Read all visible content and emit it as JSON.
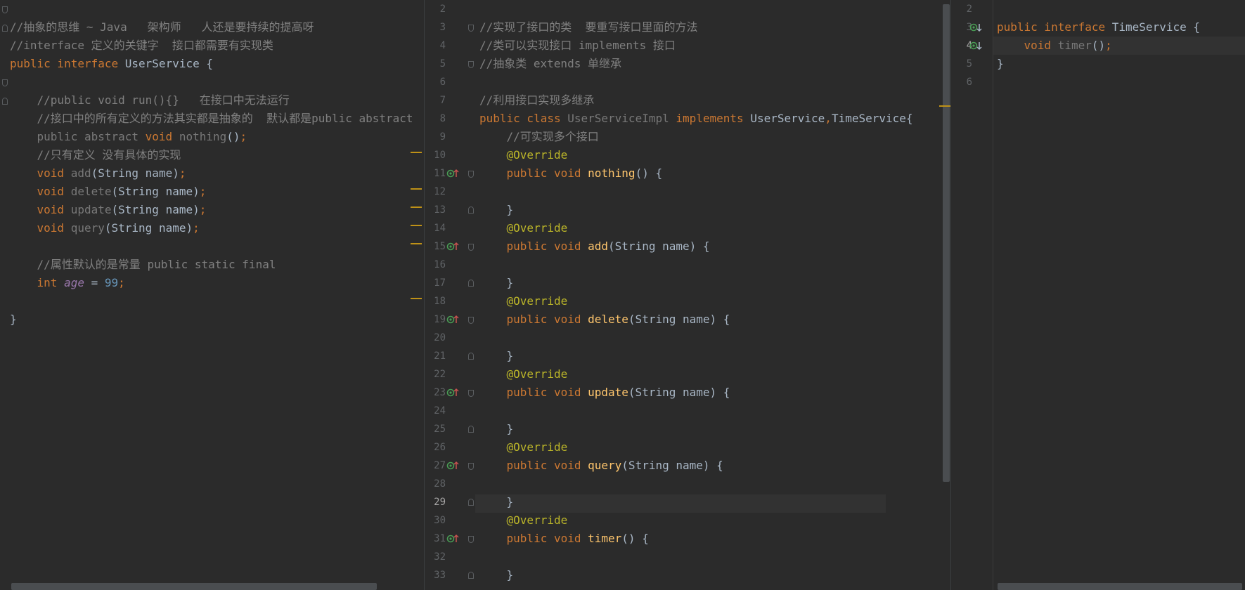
{
  "left_editor": {
    "lines": [
      {
        "row": 1,
        "parts": [
          {
            "t": "//抽象的思维 ~ Java   架构师   人还是要持续的提高呀",
            "c": "cm"
          }
        ]
      },
      {
        "row": 2,
        "parts": [
          {
            "t": "//interface 定义的关键字  接口都需要有实现类",
            "c": "cm"
          }
        ]
      },
      {
        "row": 3,
        "parts": [
          {
            "t": "public interface ",
            "c": "kw"
          },
          {
            "t": "UserService {",
            "c": "cl"
          }
        ]
      },
      {
        "row": 5,
        "parts": [
          {
            "t": "    //public void run(){}   在接口中无法运行",
            "c": "cm"
          }
        ]
      },
      {
        "row": 6,
        "parts": [
          {
            "t": "    //接口中的所有定义的方法其实都是抽象的  默认都是public abstract",
            "c": "cm"
          }
        ]
      },
      {
        "row": 7,
        "parts": [
          {
            "t": "    public abstract ",
            "c": "dim"
          },
          {
            "t": "void ",
            "c": "kw"
          },
          {
            "t": "nothing",
            "c": "dim"
          },
          {
            "t": "()",
            "c": "cl"
          },
          {
            "t": ";",
            "c": "sc"
          }
        ]
      },
      {
        "row": 8,
        "parts": [
          {
            "t": "    //只有定义 没有具体的实现",
            "c": "cm"
          }
        ]
      },
      {
        "row": 9,
        "parts": [
          {
            "t": "    void ",
            "c": "kw"
          },
          {
            "t": "add",
            "c": "dim"
          },
          {
            "t": "(String name)",
            "c": "cl"
          },
          {
            "t": ";",
            "c": "sc"
          }
        ]
      },
      {
        "row": 10,
        "parts": [
          {
            "t": "    void ",
            "c": "kw"
          },
          {
            "t": "delete",
            "c": "dim"
          },
          {
            "t": "(String name)",
            "c": "cl"
          },
          {
            "t": ";",
            "c": "sc"
          }
        ]
      },
      {
        "row": 11,
        "parts": [
          {
            "t": "    void ",
            "c": "kw"
          },
          {
            "t": "update",
            "c": "dim"
          },
          {
            "t": "(String name)",
            "c": "cl"
          },
          {
            "t": ";",
            "c": "sc"
          }
        ]
      },
      {
        "row": 12,
        "parts": [
          {
            "t": "    void ",
            "c": "kw"
          },
          {
            "t": "query",
            "c": "dim"
          },
          {
            "t": "(String name)",
            "c": "cl"
          },
          {
            "t": ";",
            "c": "sc"
          }
        ]
      },
      {
        "row": 14,
        "parts": [
          {
            "t": "    //属性默认的是常量 ",
            "c": "cm"
          },
          {
            "t": "public static final",
            "c": "gr"
          }
        ]
      },
      {
        "row": 15,
        "parts": [
          {
            "t": "    int ",
            "c": "kw"
          },
          {
            "t": "age",
            "c": "fd"
          },
          {
            "t": " = ",
            "c": "cl"
          },
          {
            "t": "99",
            "c": "nm"
          },
          {
            "t": ";",
            "c": "sc"
          }
        ]
      },
      {
        "row": 17,
        "parts": [
          {
            "t": "}",
            "c": "cl"
          }
        ]
      }
    ]
  },
  "middle_editor": {
    "line_numbers": [
      "2",
      "3",
      "4",
      "5",
      "6",
      "7",
      "8",
      "9",
      "10",
      "11",
      "12",
      "13",
      "14",
      "15",
      "16",
      "17",
      "18",
      "19",
      "20",
      "21",
      "22",
      "23",
      "24",
      "25",
      "26",
      "27",
      "28",
      "29",
      "30",
      "31",
      "32",
      "33"
    ],
    "current_line": "29",
    "lines": [
      {
        "row": 1,
        "parts": [
          {
            "t": "//实现了接口的类  要重写接口里面的方法",
            "c": "cm"
          }
        ]
      },
      {
        "row": 2,
        "parts": [
          {
            "t": "//类可以实现接口 implements 接口",
            "c": "cm"
          }
        ]
      },
      {
        "row": 3,
        "parts": [
          {
            "t": "//抽象类 extends 单继承",
            "c": "cm"
          }
        ]
      },
      {
        "row": 5,
        "parts": [
          {
            "t": "//利用接口实现多继承",
            "c": "cm"
          }
        ]
      },
      {
        "row": 6,
        "parts": [
          {
            "t": "public class ",
            "c": "kw"
          },
          {
            "t": "UserServiceImpl ",
            "c": "dim"
          },
          {
            "t": "implements ",
            "c": "kw"
          },
          {
            "t": "UserService",
            "c": "cl"
          },
          {
            "t": ",",
            "c": "sc"
          },
          {
            "t": "TimeService{",
            "c": "cl"
          }
        ]
      },
      {
        "row": 7,
        "parts": [
          {
            "t": "    //可实现多个接口",
            "c": "cm"
          }
        ]
      },
      {
        "row": 8,
        "parts": [
          {
            "t": "    @Override",
            "c": "an"
          }
        ]
      },
      {
        "row": 9,
        "parts": [
          {
            "t": "    public void ",
            "c": "kw"
          },
          {
            "t": "nothing",
            "c": "fn"
          },
          {
            "t": "() {",
            "c": "cl"
          }
        ]
      },
      {
        "row": 11,
        "parts": [
          {
            "t": "    }",
            "c": "cl"
          }
        ]
      },
      {
        "row": 12,
        "parts": [
          {
            "t": "    @Override",
            "c": "an"
          }
        ]
      },
      {
        "row": 13,
        "parts": [
          {
            "t": "    public void ",
            "c": "kw"
          },
          {
            "t": "add",
            "c": "fn"
          },
          {
            "t": "(String name) {",
            "c": "cl"
          }
        ]
      },
      {
        "row": 15,
        "parts": [
          {
            "t": "    }",
            "c": "cl"
          }
        ]
      },
      {
        "row": 16,
        "parts": [
          {
            "t": "    @Override",
            "c": "an"
          }
        ]
      },
      {
        "row": 17,
        "parts": [
          {
            "t": "    public void ",
            "c": "kw"
          },
          {
            "t": "delete",
            "c": "fn"
          },
          {
            "t": "(String name) {",
            "c": "cl"
          }
        ]
      },
      {
        "row": 19,
        "parts": [
          {
            "t": "    }",
            "c": "cl"
          }
        ]
      },
      {
        "row": 20,
        "parts": [
          {
            "t": "    @Override",
            "c": "an"
          }
        ]
      },
      {
        "row": 21,
        "parts": [
          {
            "t": "    public void ",
            "c": "kw"
          },
          {
            "t": "update",
            "c": "fn"
          },
          {
            "t": "(String name) {",
            "c": "cl"
          }
        ]
      },
      {
        "row": 23,
        "parts": [
          {
            "t": "    }",
            "c": "cl"
          }
        ]
      },
      {
        "row": 24,
        "parts": [
          {
            "t": "    @Override",
            "c": "an"
          }
        ]
      },
      {
        "row": 25,
        "parts": [
          {
            "t": "    public void ",
            "c": "kw"
          },
          {
            "t": "query",
            "c": "fn"
          },
          {
            "t": "(String name) {",
            "c": "cl"
          }
        ]
      },
      {
        "row": 27,
        "parts": [
          {
            "t": "    }",
            "c": "cl"
          }
        ]
      },
      {
        "row": 28,
        "parts": [
          {
            "t": "    @Override",
            "c": "an"
          }
        ]
      },
      {
        "row": 29,
        "parts": [
          {
            "t": "    public void ",
            "c": "kw"
          },
          {
            "t": "timer",
            "c": "fn"
          },
          {
            "t": "() {",
            "c": "cl"
          }
        ]
      },
      {
        "row": 31,
        "parts": [
          {
            "t": "    }",
            "c": "cl"
          }
        ]
      }
    ]
  },
  "right_editor": {
    "line_numbers": [
      "2",
      "3",
      "4",
      "5",
      "6"
    ],
    "current_line": "4",
    "lines": [
      {
        "row": 1,
        "parts": [
          {
            "t": "public interface ",
            "c": "kw"
          },
          {
            "t": "TimeService {",
            "c": "cl"
          }
        ]
      },
      {
        "row": 2,
        "parts": [
          {
            "t": "    void ",
            "c": "kw"
          },
          {
            "t": "timer",
            "c": "dim"
          },
          {
            "t": "()",
            "c": "cl"
          },
          {
            "t": ";",
            "c": "sc"
          }
        ]
      },
      {
        "row": 3,
        "parts": [
          {
            "t": "}",
            "c": "cl"
          }
        ]
      }
    ]
  },
  "theme": {
    "background": "#2b2b2b",
    "gutter": "#313335",
    "keyword": "#cc7832",
    "comment": "#808080",
    "annotation": "#bbb529",
    "method": "#ffc66d",
    "number": "#6897bb",
    "field": "#9876aa",
    "implement_icon": "#499c54",
    "override_arrow": "#c75450"
  }
}
